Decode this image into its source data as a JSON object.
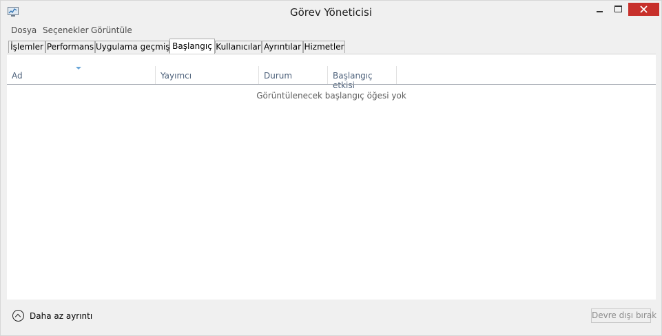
{
  "window": {
    "title": "Görev Yöneticisi",
    "icon": "task-manager-icon"
  },
  "title_buttons": [
    "minimize-icon",
    "maximize-icon",
    "close-icon"
  ],
  "menu": {
    "items": [
      "Dosya",
      "Seçenekler",
      "Görüntüle"
    ]
  },
  "tabs": {
    "items": [
      "İşlemler",
      "Performans",
      "Uygulama geçmişi",
      "Başlangıç",
      "Kullanıcılar",
      "Ayrıntılar",
      "Hizmetler"
    ],
    "active": "Başlangıç"
  },
  "startup_table": {
    "columns": [
      "Ad",
      "Yayımcı",
      "Durum",
      "Başlangıç etkisi"
    ],
    "sort_column": "Ad",
    "empty_message": "Görüntülenecek başlangıç öğesi yok"
  },
  "footer": {
    "fewer_details_label": "Daha az ayrıntı",
    "disable_button_label": "Devre dışı bırak"
  },
  "colors": {
    "close_button": "#c7302b",
    "sort_indicator": "#6aa6d8",
    "column_header_text": "#4c607a"
  }
}
